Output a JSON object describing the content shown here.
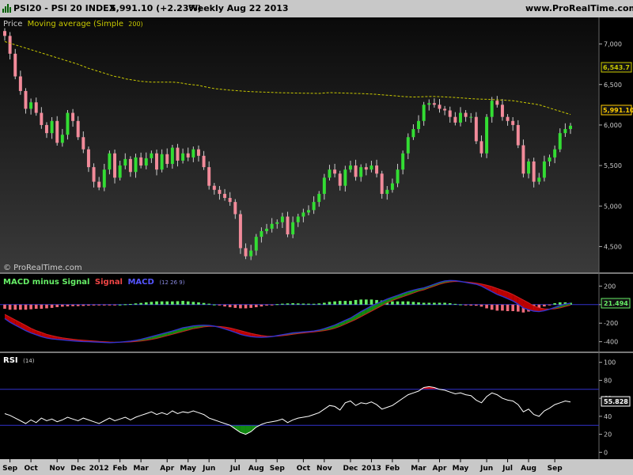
{
  "header": {
    "symbol": "PSI20 - PSI 20 INDEX",
    "price_change": "5,991.10 (+2.23%)",
    "period_date": "Weekly  Aug 22 2013",
    "site": "www.ProRealTime.com",
    "watermark": "© ProRealTime.com"
  },
  "colors": {
    "up": "#33dd33",
    "down": "#f28b9a",
    "ma": "#c8c800",
    "macd_line": "#3333cc",
    "signal_line": "#cc2222",
    "hist_pos": "#66ee66",
    "hist_neg": "#f06a7a",
    "fill_green": "#118811",
    "fill_red": "#bb0000",
    "rsi": "#ffffff",
    "band": "#3333cc"
  },
  "chart_data": [
    {
      "type": "candlestick",
      "title_prefix": "Price",
      "series_label": "Moving average (Simple",
      "series_param": "200)",
      "y_ticks": [
        "7,000",
        "6,500",
        "6,000",
        "5,500",
        "5,000",
        "4,500"
      ],
      "y_tick_values": [
        7000,
        6500,
        6000,
        5500,
        5000,
        4500
      ],
      "ylim": [
        4250,
        7250
      ],
      "last_price": 5991.1,
      "last_price_label": "5,991.10",
      "ma_last": 6543.7,
      "ma_last_label": "6,543.7",
      "close": [
        7100,
        6880,
        6600,
        6420,
        6200,
        6280,
        6150,
        6000,
        5900,
        6050,
        5780,
        5880,
        6150,
        6050,
        5850,
        5700,
        5480,
        5300,
        5230,
        5450,
        5650,
        5350,
        5500,
        5580,
        5420,
        5600,
        5500,
        5590,
        5650,
        5450,
        5640,
        5520,
        5720,
        5560,
        5650,
        5600,
        5700,
        5620,
        5480,
        5250,
        5200,
        5150,
        5100,
        5050,
        4900,
        4480,
        4380,
        4450,
        4620,
        4690,
        4720,
        4780,
        4800,
        4870,
        4650,
        4800,
        4870,
        4920,
        4950,
        5050,
        5150,
        5350,
        5450,
        5400,
        5250,
        5450,
        5500,
        5360,
        5480,
        5450,
        5500,
        5400,
        5150,
        5200,
        5280,
        5450,
        5650,
        5850,
        5950,
        6050,
        6250,
        6270,
        6250,
        6200,
        6180,
        6100,
        6030,
        6150,
        6100,
        6100,
        5800,
        5650,
        6100,
        6300,
        6250,
        6100,
        6050,
        6000,
        5750,
        5400,
        5550,
        5300,
        5350,
        5550,
        5600,
        5700,
        5900,
        5950,
        5991
      ],
      "ma": [
        7030,
        7010,
        6990,
        6970,
        6950,
        6930,
        6910,
        6890,
        6870,
        6850,
        6830,
        6810,
        6790,
        6770,
        6750,
        6725,
        6700,
        6680,
        6660,
        6640,
        6620,
        6600,
        6590,
        6570,
        6560,
        6550,
        6540,
        6535,
        6530,
        6530,
        6530,
        6530,
        6530,
        6525,
        6515,
        6503,
        6497,
        6490,
        6475,
        6462,
        6450,
        6443,
        6437,
        6430,
        6425,
        6420,
        6415,
        6413,
        6410,
        6408,
        6405,
        6403,
        6400,
        6398,
        6397,
        6395,
        6394,
        6393,
        6392,
        6391,
        6390,
        6395,
        6400,
        6398,
        6396,
        6394,
        6392,
        6390,
        6388,
        6385,
        6382,
        6378,
        6372,
        6368,
        6363,
        6358,
        6352,
        6348,
        6346,
        6347,
        6350,
        6352,
        6352,
        6350,
        6347,
        6343,
        6340,
        6335,
        6330,
        6326,
        6322,
        6320,
        6318,
        6315,
        6312,
        6308,
        6304,
        6300,
        6290,
        6280,
        6270,
        6260,
        6250,
        6230,
        6210,
        6190,
        6170,
        6150,
        6130
      ]
    },
    {
      "type": "macd",
      "title_hist": "MACD minus Signal",
      "title_signal": "Signal",
      "title_macd": "MACD",
      "params": "(12 26 9)",
      "y_ticks": [
        "200",
        "0",
        "-200",
        "-400"
      ],
      "y_tick_values": [
        200,
        0,
        -200,
        -400
      ],
      "ylim": [
        -480,
        280
      ],
      "last_value": 21.494,
      "last_value_label": "21.494",
      "macd": [
        -150,
        -190,
        -220,
        -250,
        -280,
        -305,
        -325,
        -345,
        -360,
        -370,
        -375,
        -380,
        -385,
        -390,
        -395,
        -398,
        -400,
        -402,
        -405,
        -408,
        -410,
        -408,
        -405,
        -400,
        -395,
        -385,
        -375,
        -360,
        -345,
        -330,
        -315,
        -300,
        -285,
        -268,
        -250,
        -240,
        -230,
        -225,
        -222,
        -225,
        -232,
        -245,
        -262,
        -280,
        -300,
        -320,
        -335,
        -345,
        -350,
        -352,
        -350,
        -345,
        -335,
        -325,
        -315,
        -305,
        -300,
        -295,
        -290,
        -285,
        -275,
        -260,
        -240,
        -220,
        -195,
        -170,
        -145,
        -110,
        -75,
        -45,
        -15,
        10,
        35,
        60,
        80,
        100,
        120,
        140,
        155,
        170,
        180,
        200,
        220,
        240,
        255,
        260,
        258,
        250,
        240,
        230,
        220,
        200,
        170,
        140,
        110,
        90,
        65,
        40,
        5,
        -35,
        -55,
        -70,
        -75,
        -65,
        -50,
        -30,
        -10,
        5,
        15
      ],
      "signal": [
        -105,
        -135,
        -165,
        -195,
        -225,
        -255,
        -280,
        -300,
        -320,
        -335,
        -348,
        -358,
        -366,
        -373,
        -379,
        -384,
        -389,
        -393,
        -397,
        -400,
        -403,
        -405,
        -405,
        -404,
        -402,
        -398,
        -393,
        -385,
        -375,
        -365,
        -350,
        -335,
        -320,
        -305,
        -290,
        -275,
        -260,
        -250,
        -240,
        -235,
        -233,
        -236,
        -242,
        -252,
        -265,
        -280,
        -295,
        -310,
        -322,
        -332,
        -340,
        -342,
        -340,
        -335,
        -328,
        -320,
        -313,
        -306,
        -300,
        -294,
        -288,
        -280,
        -270,
        -255,
        -235,
        -210,
        -185,
        -160,
        -130,
        -100,
        -70,
        -40,
        -10,
        20,
        45,
        65,
        85,
        105,
        125,
        145,
        160,
        180,
        200,
        220,
        235,
        245,
        250,
        248,
        245,
        240,
        232,
        222,
        210,
        195,
        175,
        155,
        135,
        110,
        80,
        50,
        20,
        -15,
        -35,
        -45,
        -48,
        -45,
        -35,
        -20,
        -5
      ]
    },
    {
      "type": "line",
      "title": "RSI",
      "params": "(14)",
      "y_ticks": [
        "100",
        "80",
        "60",
        "40",
        "20",
        "0"
      ],
      "y_tick_values": [
        100,
        80,
        60,
        40,
        20,
        0
      ],
      "ylim": [
        -5,
        105
      ],
      "upper_band": 70,
      "lower_band": 30,
      "last_value": 55.828,
      "last_value_label": "55.828",
      "values": [
        43,
        41,
        38,
        35,
        32,
        36,
        33,
        38,
        35,
        37,
        34,
        36,
        39,
        37,
        35,
        38,
        36,
        34,
        32,
        35,
        38,
        35,
        37,
        39,
        36,
        39,
        41,
        43,
        45,
        42,
        44,
        42,
        46,
        43,
        45,
        44,
        46,
        44,
        42,
        38,
        36,
        34,
        32,
        30,
        26,
        22,
        20,
        23,
        28,
        31,
        33,
        34,
        35,
        37,
        33,
        36,
        38,
        39,
        40,
        42,
        44,
        48,
        52,
        51,
        47,
        55,
        57,
        52,
        55,
        54,
        56,
        53,
        48,
        50,
        52,
        56,
        60,
        64,
        66,
        68,
        72,
        73,
        72,
        70,
        69,
        67,
        65,
        66,
        64,
        63,
        58,
        55,
        62,
        66,
        64,
        60,
        58,
        57,
        53,
        45,
        48,
        42,
        40,
        46,
        49,
        53,
        55,
        57,
        56
      ]
    }
  ],
  "x_axis": {
    "labels": [
      "Sep",
      "Oct",
      "Nov",
      "Dec",
      "2012",
      "Feb",
      "Mar",
      "Apr",
      "May",
      "Jun",
      "Jul",
      "Aug",
      "Sep",
      "Oct",
      "Nov",
      "Dec",
      "2013",
      "Feb",
      "Mar",
      "Apr",
      "May",
      "Jun",
      "Jul",
      "Aug",
      "Sep"
    ],
    "label_week_index": [
      1,
      5,
      10,
      14,
      18,
      22,
      26,
      31,
      35,
      39,
      44,
      48,
      52,
      57,
      61,
      66,
      70,
      74,
      79,
      83,
      87,
      92,
      96,
      100,
      105
    ]
  }
}
